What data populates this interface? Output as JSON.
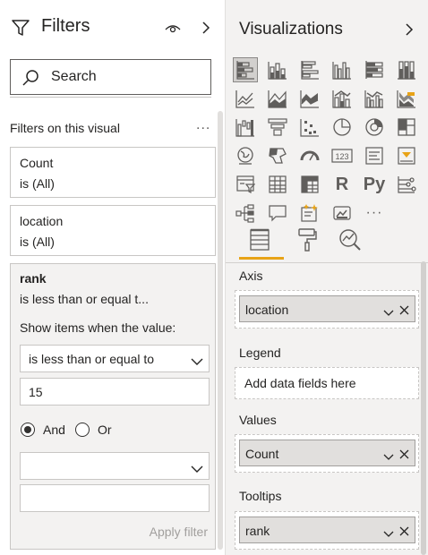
{
  "filters": {
    "title": "Filters",
    "search_placeholder": "Search",
    "section_label": "Filters on this visual",
    "more": "...",
    "cards": [
      {
        "field": "Count",
        "state": "is (All)"
      },
      {
        "field": "location",
        "state": "is (All)"
      }
    ],
    "rank": {
      "field": "rank",
      "summary": "is less than or equal t...",
      "show_label": "Show items when the value:",
      "condition1": "is less than or equal to",
      "value1": "15",
      "and_label": "And",
      "or_label": "Or",
      "logic": "And",
      "condition2": "",
      "value2": "",
      "apply_label": "Apply filter"
    }
  },
  "visualizations": {
    "title": "Visualizations",
    "icons": [
      "stacked-bar-chart-icon",
      "stacked-column-chart-icon",
      "clustered-bar-chart-icon",
      "clustered-column-chart-icon",
      "100-stacked-bar-chart-icon",
      "100-stacked-column-chart-icon",
      "line-chart-icon",
      "area-chart-icon",
      "stacked-area-chart-icon",
      "line-and-stacked-column-chart-icon",
      "line-and-clustered-column-chart-icon",
      "ribbon-chart-icon",
      "waterfall-chart-icon",
      "funnel-icon",
      "scatter-chart-icon",
      "pie-chart-icon",
      "donut-chart-icon",
      "treemap-icon",
      "map-icon",
      "filled-map-icon",
      "gauge-icon",
      "card-icon",
      "multi-row-card-icon",
      "kpi-icon",
      "slicer-icon",
      "table-icon",
      "matrix-icon",
      "r-visual-icon",
      "python-visual-icon",
      "key-influencers-icon",
      "decomposition-tree-icon",
      "qa-icon",
      "smart-narrative-icon",
      "paginated-report-icon",
      "more-visuals-icon"
    ],
    "r_label": "R",
    "py_label": "Py",
    "more_label": "···",
    "card_label": "123",
    "tabs": [
      "fields-tab",
      "format-tab",
      "analytics-tab"
    ],
    "sections": {
      "axis": {
        "label": "Axis",
        "field": "location"
      },
      "legend": {
        "label": "Legend",
        "placeholder": "Add data fields here"
      },
      "values": {
        "label": "Values",
        "field": "Count"
      },
      "tooltips": {
        "label": "Tooltips",
        "field": "rank"
      }
    },
    "accent": "#e8a317"
  }
}
